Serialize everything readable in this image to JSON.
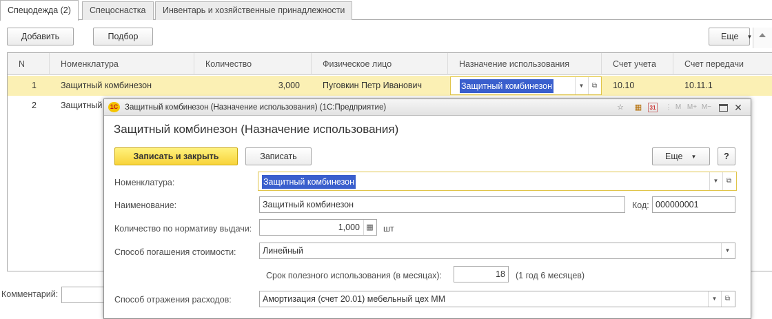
{
  "tabs": [
    {
      "label": "Спецодежда (2)"
    },
    {
      "label": "Спецоснастка"
    },
    {
      "label": "Инвентарь и хозяйственные принадлежности"
    }
  ],
  "toolbar": {
    "add_label": "Добавить",
    "select_label": "Подбор",
    "more_label": "Еще"
  },
  "table": {
    "columns": [
      "N",
      "Номенклатура",
      "Количество",
      "Физическое лицо",
      "Назначение использования",
      "Счет учета",
      "Счет передачи"
    ],
    "rows": [
      {
        "n": "1",
        "item": "Защитный комбинезон",
        "qty": "3,000",
        "person": "Пуговкин Петр Иванович",
        "purpose": "Защитный комбинезон",
        "account": "10.10",
        "transfer": "10.11.1"
      },
      {
        "n": "2",
        "item": "Защитный"
      }
    ]
  },
  "footer": {
    "comment_label": "Комментарий:"
  },
  "dialog": {
    "window_title": "Защитный комбинезон (Назначение использования) (1С:Предприятие)",
    "logo_text": "1С",
    "title_icons": [
      "bookmark-icon",
      "calculator-icon",
      "calendar-icon",
      "memory-icons",
      "restore-icon",
      "close-icon"
    ],
    "memory_labels": [
      "M",
      "M+",
      "M−"
    ],
    "calendar_day": "31",
    "header": "Защитный комбинезон (Назначение использования)",
    "buttons": {
      "save_close": "Записать и закрыть",
      "save": "Записать",
      "more": "Еще",
      "help": "?"
    },
    "fields": {
      "nomenclature_label": "Номенклатура:",
      "nomenclature_value": "Защитный комбинезон",
      "name_label": "Наименование:",
      "name_value": "Защитный комбинезон",
      "code_label": "Код:",
      "code_value": "000000001",
      "norm_qty_label": "Количество по нормативу выдачи:",
      "norm_qty_value": "1,000",
      "unit": "шт",
      "cost_method_label": "Способ погашения стоимости:",
      "cost_method_value": "Линейный",
      "useful_life_label": "Срок полезного использования (в месяцах):",
      "useful_life_value": "18",
      "useful_life_hint": "(1 год 6 месяцев)",
      "expense_method_label": "Способ отражения расходов:",
      "expense_method_value": "Амортизация (счет 20.01) мебельный цех ММ"
    }
  },
  "colors": {
    "selection_row": "#fbf0b4",
    "highlight_text": "#3a5fcd",
    "primary_button": "#f8d33a",
    "focus_border": "#e0c54a"
  }
}
